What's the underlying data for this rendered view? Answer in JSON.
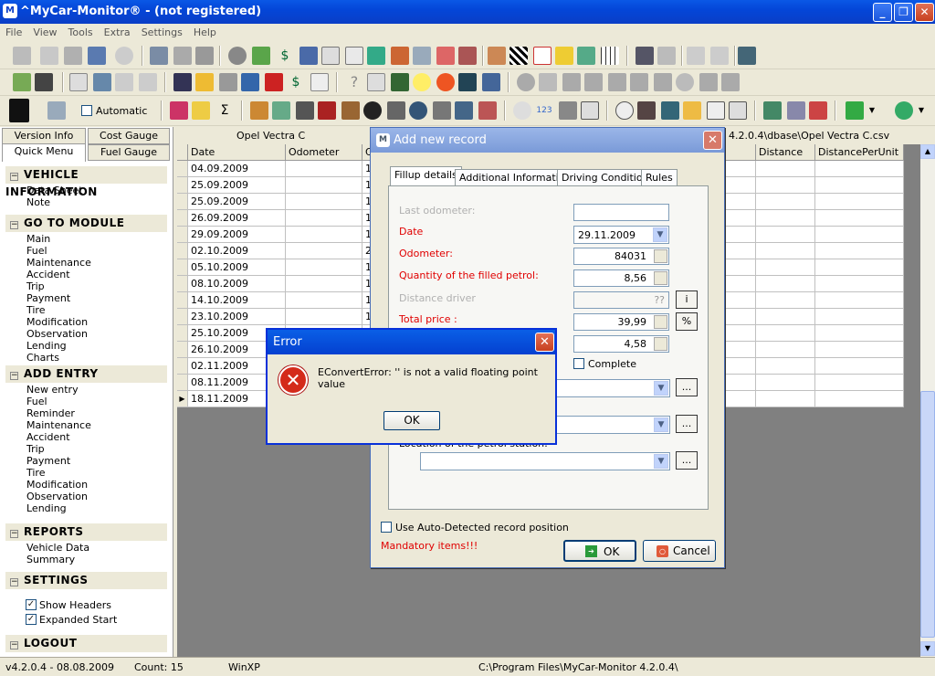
{
  "window": {
    "title": "^MyCar-Monitor® - (not registered)"
  },
  "menu": [
    "File",
    "View",
    "Tools",
    "Extra",
    "Settings",
    "Help"
  ],
  "toolbar": {
    "automatic_label": "Automatic"
  },
  "left_tabs": {
    "version_info": "Version Info",
    "cost_gauge": "Cost Gauge",
    "quick_menu": "Quick Menu",
    "fuel_gauge": "Fuel Gauge"
  },
  "quick_menu": {
    "vehicle_information": {
      "title": "VEHICLE INFORMATION",
      "items": [
        "Data Sheet",
        "Note"
      ]
    },
    "go_to_module": {
      "title": "GO TO MODULE",
      "items": [
        "Main",
        "Fuel",
        "Maintenance",
        "Accident",
        "Trip",
        "Payment",
        "Tire",
        "Modification",
        "Observation",
        "Lending",
        "Charts"
      ]
    },
    "add_entry": {
      "title": "ADD ENTRY",
      "items": [
        "New entry",
        "Fuel",
        "Reminder",
        "Maintenance",
        "Accident",
        "Trip",
        "Payment",
        "Tire",
        "Modification",
        "Observation",
        "Lending"
      ]
    },
    "reports": {
      "title": "REPORTS",
      "items": [
        "Vehicle Data",
        "Summary"
      ]
    },
    "settings": {
      "title": "SETTINGS",
      "show_headers": "Show Headers",
      "expanded_start": "Expanded Start"
    },
    "logout": {
      "title": "LOGOUT"
    }
  },
  "grid": {
    "vehicle_name": "Opel Vectra C",
    "path_text": "4.2.0.4\\dbase\\Opel Vectra C.csv",
    "columns": [
      "Date",
      "Odometer",
      "Q",
      "Distance",
      "DistancePerUnit"
    ],
    "rows": [
      {
        "date": "04.09.2009",
        "q": "1"
      },
      {
        "date": "25.09.2009",
        "q": "1"
      },
      {
        "date": "25.09.2009",
        "q": "1"
      },
      {
        "date": "26.09.2009",
        "q": "1"
      },
      {
        "date": "29.09.2009",
        "q": "1"
      },
      {
        "date": "02.10.2009",
        "q": "2"
      },
      {
        "date": "05.10.2009",
        "q": "1"
      },
      {
        "date": "08.10.2009",
        "q": "1"
      },
      {
        "date": "14.10.2009",
        "q": "1"
      },
      {
        "date": "23.10.2009",
        "q": "1"
      },
      {
        "date": "25.10.2009",
        "q": ""
      },
      {
        "date": "26.10.2009",
        "q": ""
      },
      {
        "date": "02.11.2009",
        "q": ""
      },
      {
        "date": "08.11.2009",
        "q": ""
      },
      {
        "date": "18.11.2009",
        "q": ""
      }
    ]
  },
  "add_record": {
    "title": "Add new record",
    "tabs": [
      "Fillup details",
      "Additional Information",
      "Driving Condition",
      "Rules"
    ],
    "last_odometer_label": "Last odometer:",
    "date_label": "Date",
    "date_value": "29.11.2009",
    "odometer_label": "Odometer:",
    "odometer_value": "84031",
    "quantity_label": "Quantity of the filled petrol:",
    "quantity_value": "8,56",
    "distance_label": "Distance driver",
    "distance_value": "??",
    "total_price_label": "Total price :",
    "total_price_value": "39,99",
    "unit_price_value": "4,58",
    "complete_label": "Complete",
    "location_label": "Location of the petrol station:",
    "info_button": "i",
    "percent_button": "%",
    "more_button": "...",
    "auto_detect_label": "Use Auto-Detected record position",
    "mandatory_label": "Mandatory items!!!",
    "ok_label": "OK",
    "cancel_label": "Cancel"
  },
  "error_dialog": {
    "title": "Error",
    "message": "EConvertError: '' is not a valid floating point value",
    "ok_label": "OK"
  },
  "status": {
    "version": "v4.2.0.4 - 08.08.2009",
    "count": "Count: 15",
    "os": "WinXP",
    "path": "C:\\Program Files\\MyCar-Monitor 4.2.0.4\\"
  }
}
